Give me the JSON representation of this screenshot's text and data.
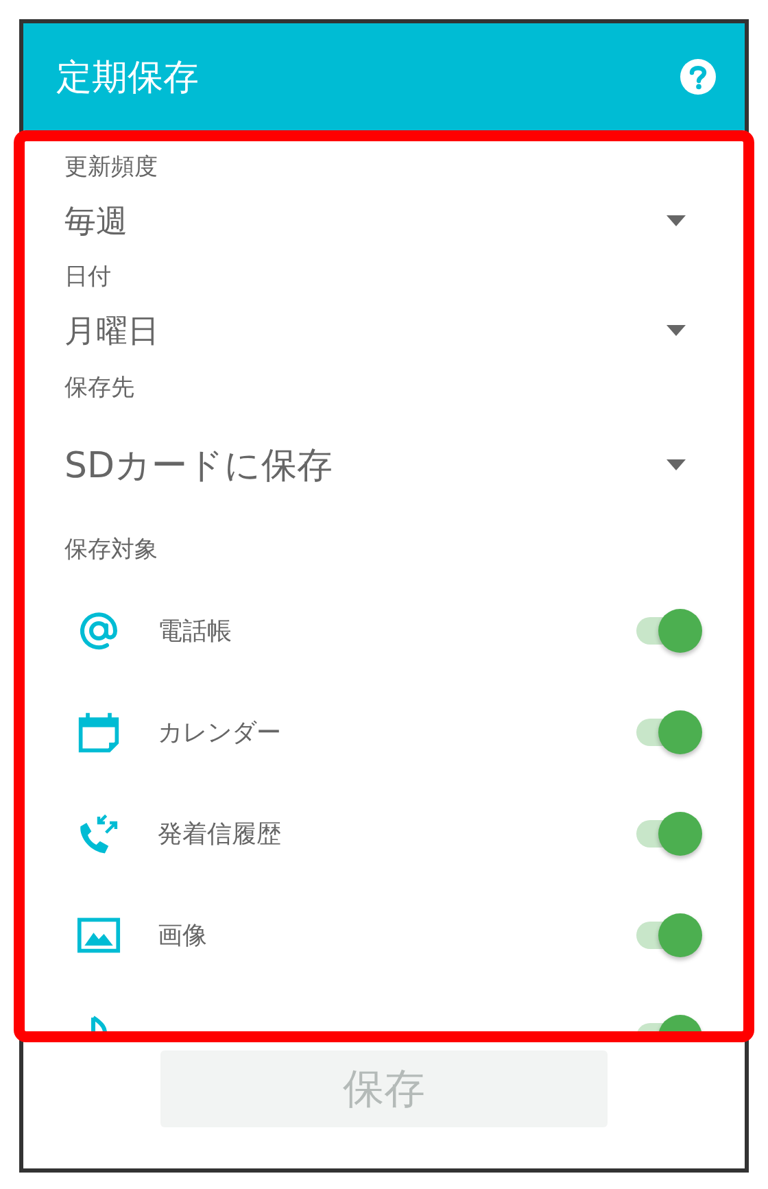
{
  "header": {
    "title": "定期保存"
  },
  "settings": [
    {
      "label": "更新頻度",
      "value": "毎週",
      "kind": "compact"
    },
    {
      "label": "日付",
      "value": "月曜日",
      "kind": "compact"
    },
    {
      "label": "保存先",
      "value": "SDカードに保存",
      "kind": "large"
    }
  ],
  "targets": {
    "label": "保存対象",
    "items": [
      {
        "kind": "at",
        "label": "電話帳",
        "checked": true
      },
      {
        "kind": "calendar",
        "label": "カレンダー",
        "checked": true
      },
      {
        "kind": "calls",
        "label": "発着信履歴",
        "checked": true
      },
      {
        "kind": "image",
        "label": "画像",
        "checked": true
      },
      {
        "kind": "music",
        "checked": true
      }
    ]
  },
  "save_button": {
    "label": "保存",
    "disabled": true
  }
}
